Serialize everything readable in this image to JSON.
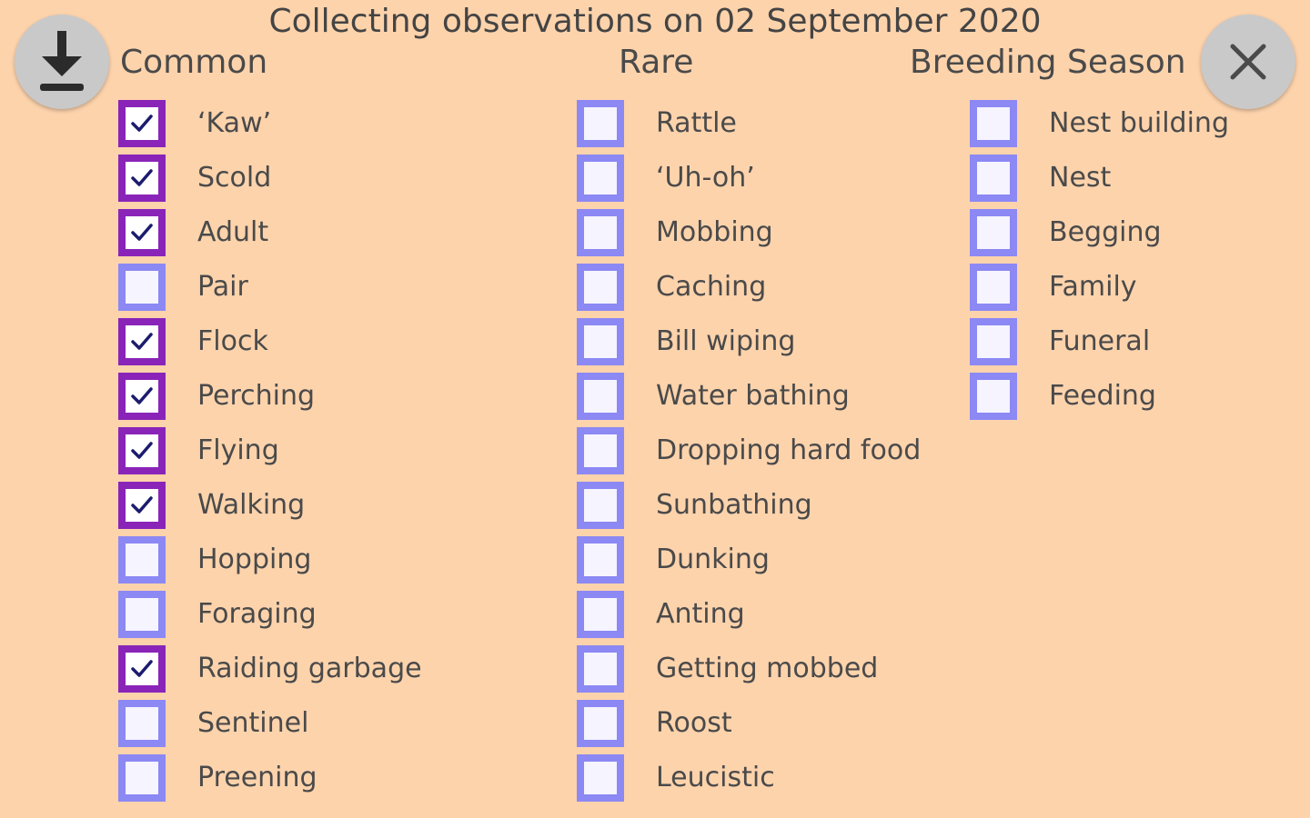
{
  "title": "Collecting observations on 02 September 2020",
  "icons": {
    "download": "download-icon",
    "close": "close-icon",
    "check": "check-icon"
  },
  "colors": {
    "background": "#FDD3AC",
    "checked_border": "#8a24b8",
    "unchecked_border": "#8c88f4",
    "button": "#c9c9c9"
  },
  "columns": {
    "common": {
      "header": "Common",
      "items": [
        {
          "label": "‘Kaw’",
          "checked": true
        },
        {
          "label": "Scold",
          "checked": true
        },
        {
          "label": "Adult",
          "checked": true
        },
        {
          "label": "Pair",
          "checked": false
        },
        {
          "label": "Flock",
          "checked": true
        },
        {
          "label": "Perching",
          "checked": true
        },
        {
          "label": "Flying",
          "checked": true
        },
        {
          "label": "Walking",
          "checked": true
        },
        {
          "label": "Hopping",
          "checked": false
        },
        {
          "label": "Foraging",
          "checked": false
        },
        {
          "label": "Raiding garbage",
          "checked": true
        },
        {
          "label": "Sentinel",
          "checked": false
        },
        {
          "label": "Preening",
          "checked": false
        }
      ]
    },
    "rare": {
      "header": "Rare",
      "items": [
        {
          "label": "Rattle",
          "checked": false
        },
        {
          "label": "‘Uh-oh’",
          "checked": false
        },
        {
          "label": "Mobbing",
          "checked": false
        },
        {
          "label": "Caching",
          "checked": false
        },
        {
          "label": "Bill wiping",
          "checked": false
        },
        {
          "label": "Water bathing",
          "checked": false
        },
        {
          "label": "Dropping hard food",
          "checked": false
        },
        {
          "label": "Sunbathing",
          "checked": false
        },
        {
          "label": "Dunking",
          "checked": false
        },
        {
          "label": "Anting",
          "checked": false
        },
        {
          "label": "Getting mobbed",
          "checked": false
        },
        {
          "label": "Roost",
          "checked": false
        },
        {
          "label": "Leucistic",
          "checked": false
        }
      ]
    },
    "breeding": {
      "header": "Breeding Season",
      "items": [
        {
          "label": "Nest building",
          "checked": false
        },
        {
          "label": "Nest",
          "checked": false
        },
        {
          "label": "Begging",
          "checked": false
        },
        {
          "label": "Family",
          "checked": false
        },
        {
          "label": "Funeral",
          "checked": false
        },
        {
          "label": "Feeding",
          "checked": false
        }
      ]
    }
  }
}
